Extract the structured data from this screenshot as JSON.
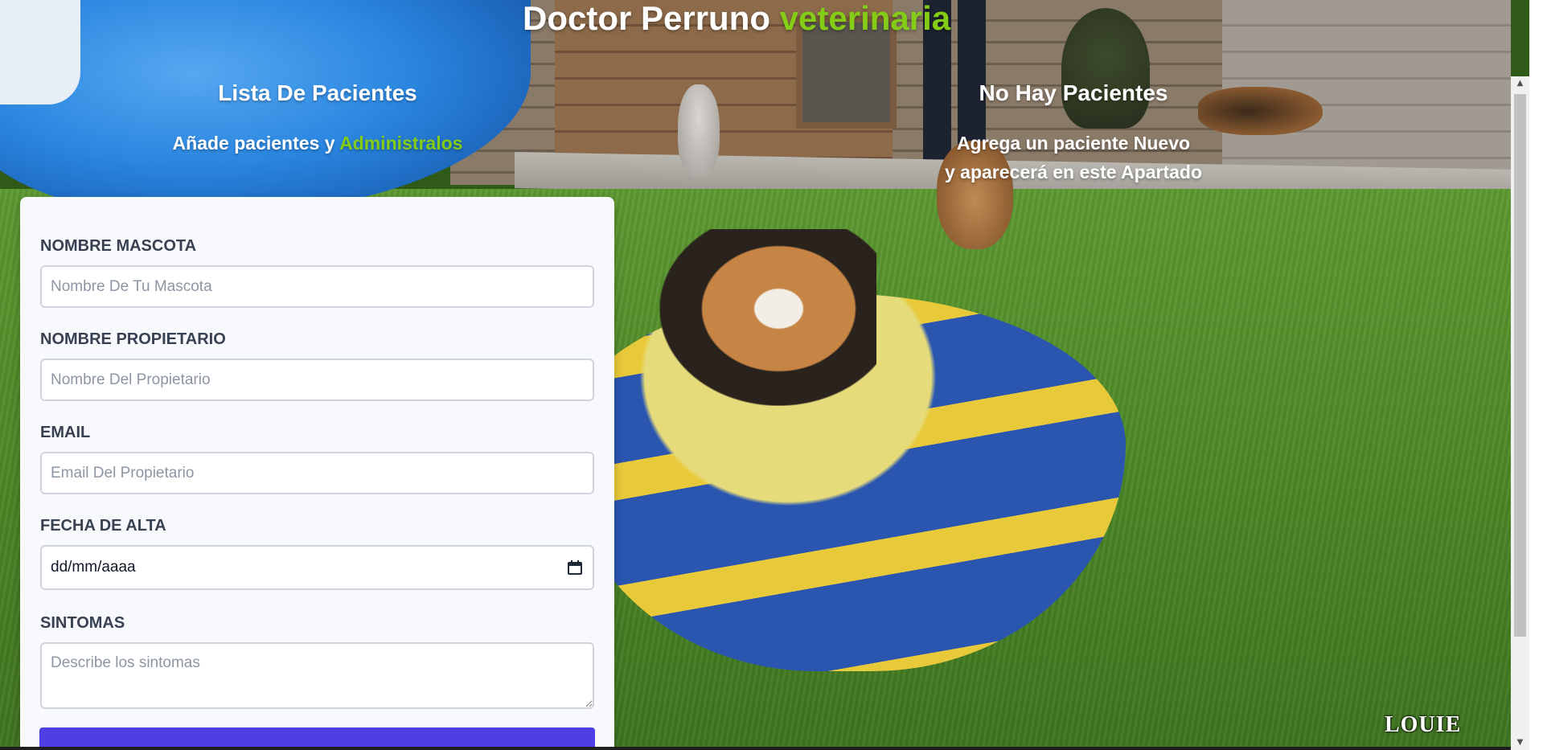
{
  "header": {
    "title_main": "Doctor Perruno",
    "title_accent": "veterinaria"
  },
  "left_column": {
    "title": "Lista De Pacientes",
    "subtitle_main": "Añade pacientes y",
    "subtitle_accent": "Administralos"
  },
  "right_column": {
    "title": "No Hay Pacientes",
    "subtitle_line1": "Agrega un paciente Nuevo",
    "subtitle_line2": "y aparecerá en este Apartado"
  },
  "form": {
    "pet_name": {
      "label": "Nombre Mascota",
      "placeholder": "Nombre De Tu Mascota",
      "value": ""
    },
    "owner_name": {
      "label": "Nombre Propietario",
      "placeholder": "Nombre Del Propietario",
      "value": ""
    },
    "email": {
      "label": "Email",
      "placeholder": "Email Del Propietario",
      "value": ""
    },
    "discharge_date": {
      "label": "Fecha De Alta",
      "display": "dd/mm/aaaa"
    },
    "symptoms": {
      "label": "Sintomas",
      "placeholder": "Describe los sintomas",
      "value": ""
    }
  },
  "watermark": "LOUIE",
  "colors": {
    "accent": "#84cc16",
    "card_bg": "#f8f9fc",
    "button": "#4f3ee6",
    "label": "#374151"
  },
  "icons": {
    "date_picker": "calendar-icon",
    "resize_handle": "resize-grip-icon"
  }
}
